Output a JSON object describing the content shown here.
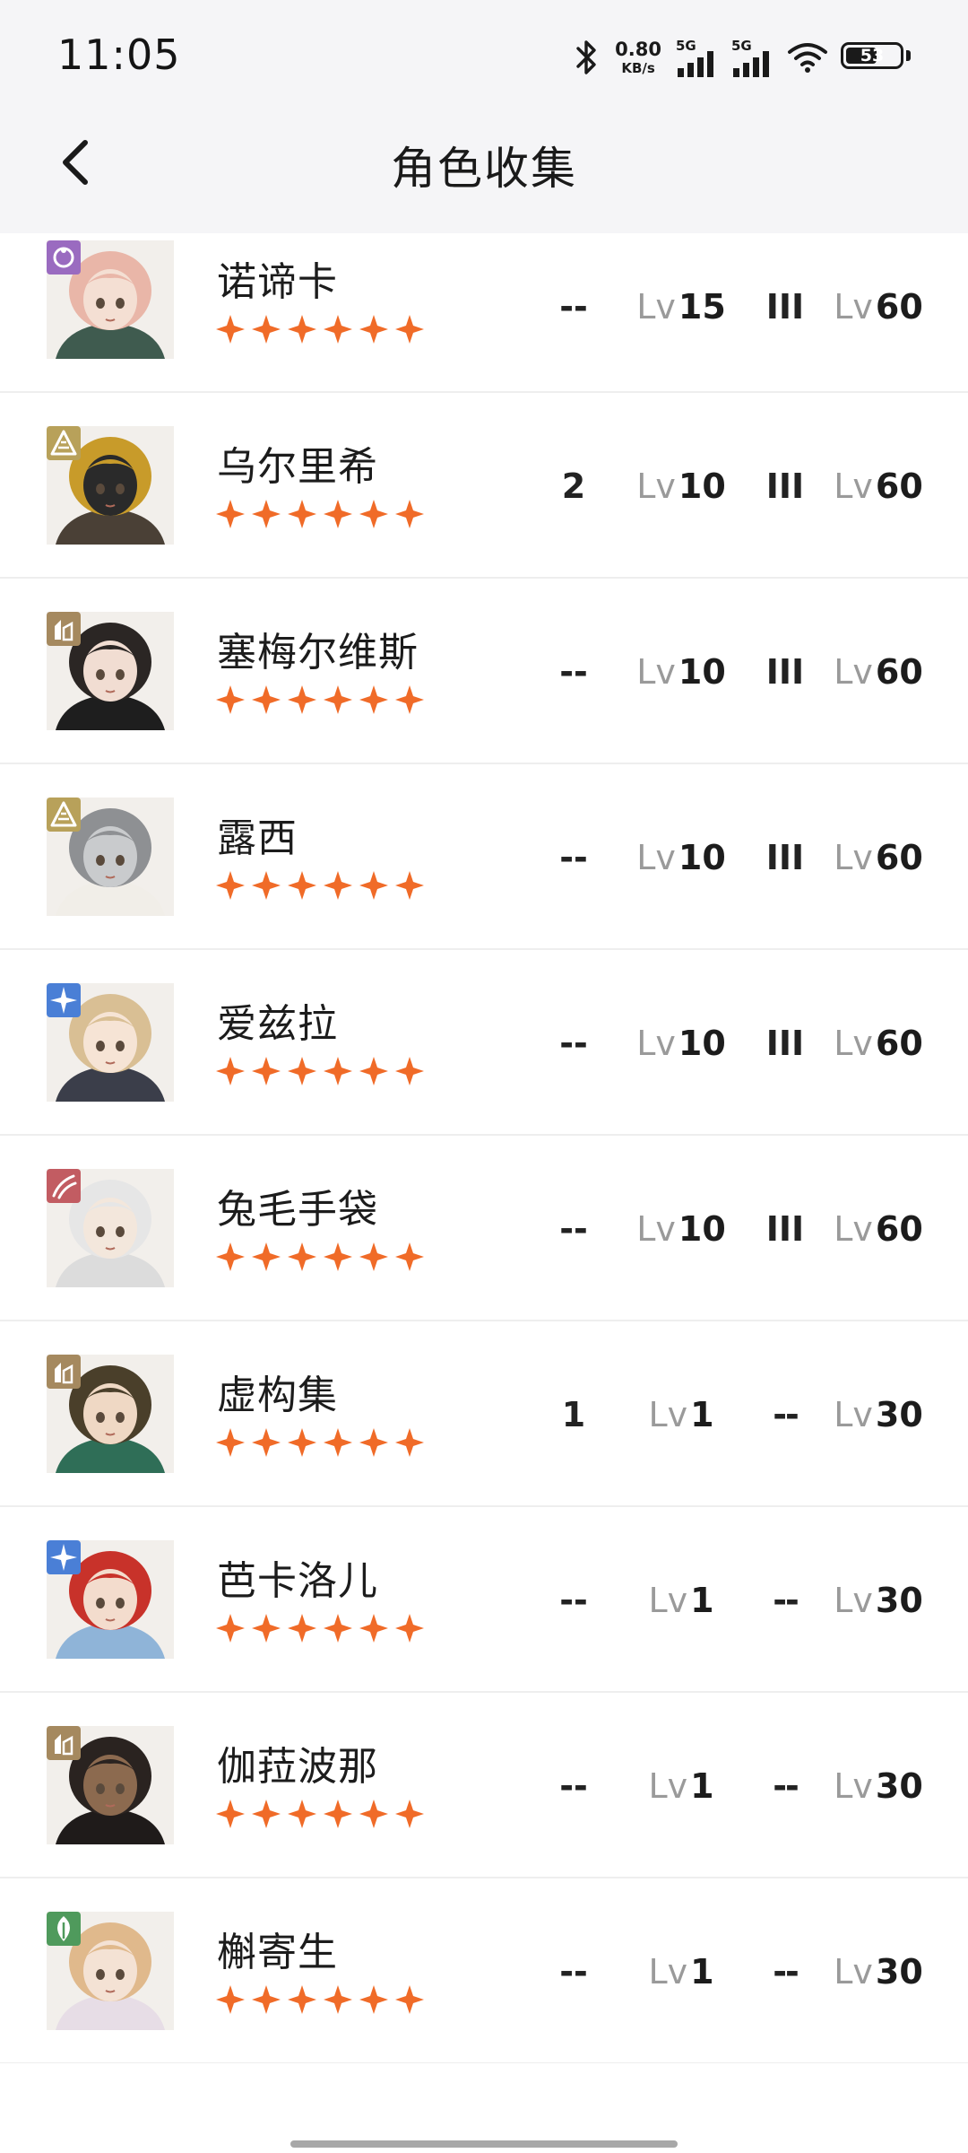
{
  "status_bar": {
    "time": "11:05",
    "net_speed_value": "0.80",
    "net_speed_unit": "KB/s",
    "sim1_label": "5G",
    "sim2_label": "5G",
    "battery_level": "53",
    "icons": [
      "bluetooth-icon",
      "signal-icon",
      "signal-icon",
      "wifi-icon",
      "battery-icon"
    ]
  },
  "header": {
    "title": "角色收集",
    "back_icon": "chevron-left-icon"
  },
  "colors": {
    "star": "#f06b28",
    "attr_star": "#9a6bc0",
    "attr_mineral": "#b8a15a",
    "attr_beast": "#a5895f",
    "attr_spirit": "#4a7fd6",
    "attr_plant": "#4f9a5c",
    "attr_rabbit": "#c25c62"
  },
  "lv_prefix": "Lv",
  "characters": [
    {
      "name": "诺谛卡",
      "stars": 6,
      "attr": "star",
      "attr_icon": "moon-icon",
      "duplicates": "--",
      "level": "15",
      "insight": "III",
      "max_level": "60",
      "hair": "#e9b6a8",
      "skin": "#f4dfd3",
      "cloth": "#3f5b4f"
    },
    {
      "name": "乌尔里希",
      "stars": 6,
      "attr": "mineral",
      "attr_icon": "mineral-icon",
      "duplicates": "2",
      "level": "10",
      "insight": "III",
      "max_level": "60",
      "hair": "#c89b2a",
      "skin": "#2a2a2a",
      "cloth": "#4a4036"
    },
    {
      "name": "塞梅尔维斯",
      "stars": 6,
      "attr": "beast",
      "attr_icon": "beast-icon",
      "duplicates": "--",
      "level": "10",
      "insight": "III",
      "max_level": "60",
      "hair": "#2b2624",
      "skin": "#f1ddd2",
      "cloth": "#1e1e1e"
    },
    {
      "name": "露西",
      "stars": 6,
      "attr": "mineral",
      "attr_icon": "mineral-icon",
      "duplicates": "--",
      "level": "10",
      "insight": "III",
      "max_level": "60",
      "hair": "#8e9093",
      "skin": "#c9cbcd",
      "cloth": "#f1eee8"
    },
    {
      "name": "爱兹拉",
      "stars": 6,
      "attr": "spirit",
      "attr_icon": "spirit-icon",
      "duplicates": "--",
      "level": "10",
      "insight": "III",
      "max_level": "60",
      "hair": "#d9bf94",
      "skin": "#f6e4d5",
      "cloth": "#3b3e4a"
    },
    {
      "name": "兔毛手袋",
      "stars": 6,
      "attr": "rabbit",
      "attr_icon": "claw-icon",
      "duplicates": "--",
      "level": "10",
      "insight": "III",
      "max_level": "60",
      "hair": "#e6e6e6",
      "skin": "#f3e7dc",
      "cloth": "#dcdcdc"
    },
    {
      "name": "虚构集",
      "stars": 6,
      "attr": "beast",
      "attr_icon": "beast-icon",
      "duplicates": "1",
      "level": "1",
      "insight": "--",
      "max_level": "30",
      "hair": "#4a3f2a",
      "skin": "#efd8c4",
      "cloth": "#2f6e57"
    },
    {
      "name": "芭卡洛儿",
      "stars": 6,
      "attr": "spirit",
      "attr_icon": "spirit-icon",
      "duplicates": "--",
      "level": "1",
      "insight": "--",
      "max_level": "30",
      "hair": "#c8322a",
      "skin": "#f3dccd",
      "cloth": "#8fb4d8"
    },
    {
      "name": "伽菈波那",
      "stars": 6,
      "attr": "beast",
      "attr_icon": "beast-icon",
      "duplicates": "--",
      "level": "1",
      "insight": "--",
      "max_level": "30",
      "hair": "#2a2320",
      "skin": "#8c6a4f",
      "cloth": "#1f1b1a"
    },
    {
      "name": "槲寄生",
      "stars": 6,
      "attr": "plant",
      "attr_icon": "leaf-icon",
      "duplicates": "--",
      "level": "1",
      "insight": "--",
      "max_level": "30",
      "hair": "#e0b98c",
      "skin": "#f4e2d4",
      "cloth": "#e7dde6"
    }
  ]
}
